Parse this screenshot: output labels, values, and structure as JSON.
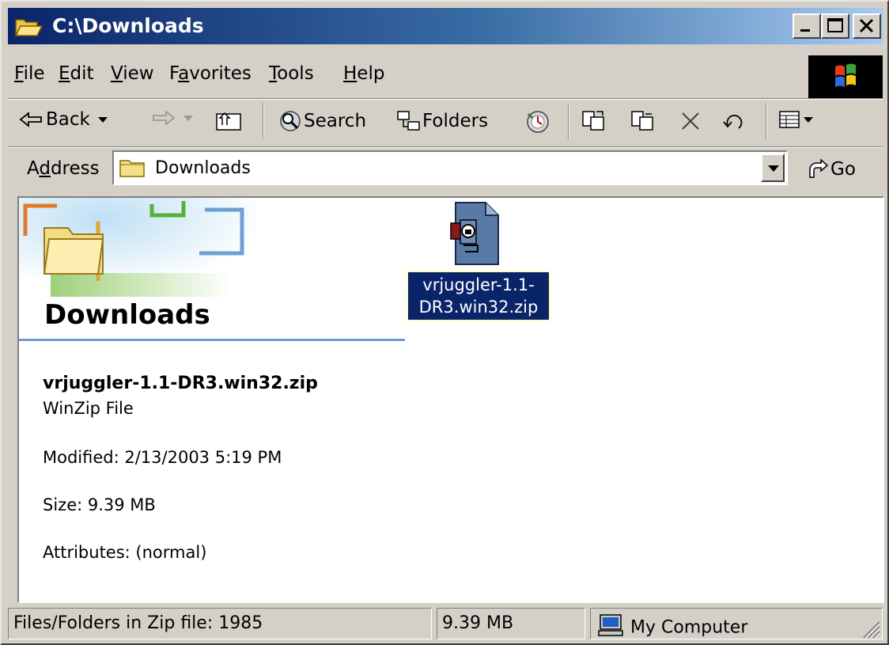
{
  "window": {
    "title": "C:\\Downloads"
  },
  "menu": {
    "file": {
      "mnemonic": "F",
      "rest": "ile"
    },
    "edit": {
      "mnemonic": "E",
      "rest": "dit"
    },
    "view": {
      "mnemonic": "V",
      "rest": "iew"
    },
    "favorites": {
      "pre": "F",
      "mnemonic": "a",
      "rest": "vorites"
    },
    "tools": {
      "mnemonic": "T",
      "rest": "ools"
    },
    "help": {
      "mnemonic": "H",
      "rest": "elp"
    }
  },
  "toolbar": {
    "back_label": "Back",
    "search_label": "Search",
    "folders_label": "Folders"
  },
  "address": {
    "label_pre": "A",
    "label_mnemonic": "d",
    "label_rest": "dress",
    "value": "Downloads",
    "go_label": "Go"
  },
  "content": {
    "folder_title": "Downloads",
    "file_icon_label_line1": "vrjuggler-1.1-",
    "file_icon_label_line2": "DR3.win32.zip",
    "details": {
      "name": "vrjuggler-1.1-DR3.win32.zip",
      "type": "WinZip File",
      "modified": "Modified: 2/13/2003 5:19 PM",
      "size": "Size: 9.39 MB",
      "attributes": "Attributes: (normal)"
    }
  },
  "status": {
    "panel1": "Files/Folders in Zip file: 1985",
    "panel2": "9.39 MB",
    "panel3": "My Computer"
  },
  "colors": {
    "title_active": "#0a246a",
    "selection": "#0a246a",
    "face": "#d4d0c8"
  }
}
